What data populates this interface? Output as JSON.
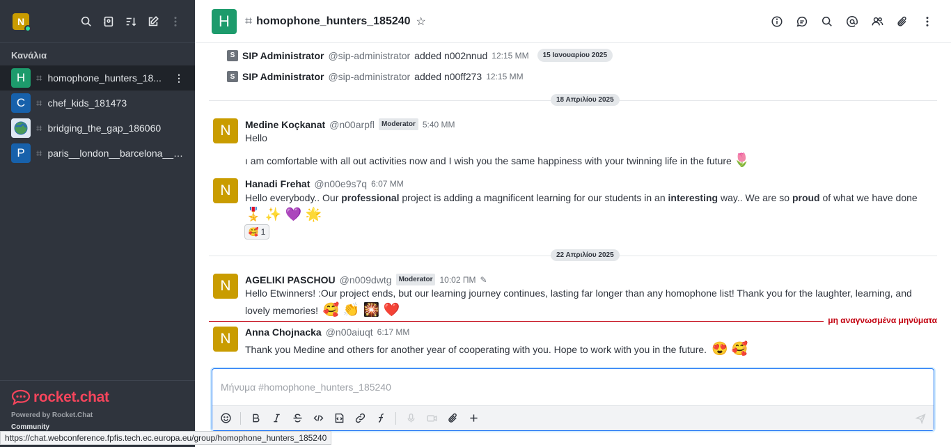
{
  "sidebar": {
    "user_initial": "N",
    "section_title": "Κανάλια",
    "channels": [
      {
        "initial": "H",
        "name": "homophone_hunters_18...",
        "color": "#1d9b6c",
        "active": true
      },
      {
        "initial": "C",
        "name": "chef_kids_181473",
        "color": "#1761ab",
        "active": false
      },
      {
        "initial": "",
        "name": "bridging_the_gap_186060",
        "color": "#9bb6d6",
        "active": false
      },
      {
        "initial": "P",
        "name": "paris__london__barcelona___...",
        "color": "#1761ab",
        "active": false
      }
    ],
    "logo_text": "rocket.chat",
    "powered_by": "Powered by Rocket.Chat",
    "community": "Community"
  },
  "header": {
    "room_initial": "H",
    "room_name": "homophone_hunters_185240"
  },
  "messages": {
    "system": [
      {
        "badge": "S",
        "user": "SIP Administrator",
        "handle": "@sip-administrator",
        "text": "added n002nnud",
        "time": "12:15 MM",
        "chip": "15 Ιανουαρίου 2025"
      },
      {
        "badge": "S",
        "user": "SIP Administrator",
        "handle": "@sip-administrator",
        "text": "added n00ff273",
        "time": "12:15 MM"
      }
    ],
    "dividers": [
      "18 Απριλίου 2025",
      "22 Απριλίου 2025"
    ],
    "m1": {
      "initial": "N",
      "user": "Medine Koçkanat",
      "handle": "@n00arpfl",
      "role": "Moderator",
      "time": "5:40 MM",
      "line1": "Hello",
      "line2": "ı am comfortable with all out activities now and I wish you the same happiness with your twinning life in the future",
      "emoji": "🌷"
    },
    "m2": {
      "initial": "N",
      "user": "Hanadi Frehat",
      "handle": "@n00e9s7q",
      "time": "6:07 MM",
      "t1": "Hello everybody.. Our ",
      "b1": "professional",
      "t2": " project is adding a magnificent learning for our students in an ",
      "b2": "interesting",
      "t3": " way.. We are so ",
      "b3": "proud",
      "t4": " of what we have done",
      "emojis": "🎖️ ✨ 💜 🌟",
      "reaction_emoji": "🥰",
      "reaction_count": "1"
    },
    "m3": {
      "initial": "N",
      "user": "AGELIKI PASCHOU",
      "handle": "@n009dwtg",
      "role": "Moderator",
      "time": "10:02 ΠΜ",
      "line1": "Hello Etwinners! :Our project ends, but our learning journey continues, lasting far longer than any homophone list! Thank you for the laughter, learning, and",
      "line2": "lovely memories!",
      "emojis": "🥰 👏 🎇 ❤️"
    },
    "unread_label": "μη αναγνωσμένα μηνύματα",
    "m4": {
      "initial": "N",
      "user": "Anna Chojnacka",
      "handle": "@n00aiuqt",
      "time": "6:17 MM",
      "line1": "Thank you Medine and others for another year of cooperating with you. Hope to work with you in the future.",
      "emojis": "😍 🥰"
    }
  },
  "composer": {
    "placeholder": "Μήνυμα #homophone_hunters_185240"
  },
  "statusbar": {
    "url": "https://chat.webconference.fpfis.tech.ec.europa.eu/group/homophone_hunters_185240"
  },
  "colors": {
    "sidebar_bg": "#2f343d",
    "brand_red": "#f5455c",
    "unread_red": "#c2000f",
    "focus_blue": "#1d74f5",
    "user_avatar": "#c99c00"
  }
}
